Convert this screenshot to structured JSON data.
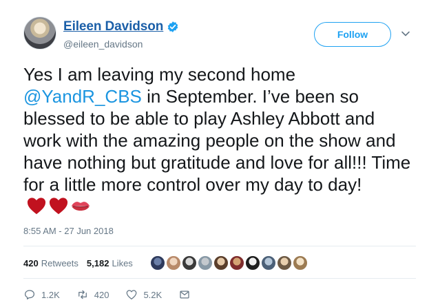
{
  "user": {
    "display_name": "Eileen Davidson",
    "handle": "@eileen_davidson",
    "verified": true
  },
  "follow_label": "Follow",
  "tweet": {
    "text_before": "Yes I am leaving my second home ",
    "mention": "@YandR_CBS",
    "text_after": " in September. I’ve been so blessed to be able to play Ashley Abbott and work with the amazing people on the show and have nothing but gratitude and love for all!!! Time for a little more control over my day to day!",
    "emojis": [
      "heart-icon",
      "heart-icon",
      "kiss-icon"
    ]
  },
  "timestamp": "8:55 AM - 27 Jun 2018",
  "stats": {
    "retweets_count": "420",
    "retweets_label": "Retweets",
    "likes_count": "5,182",
    "likes_label": "Likes"
  },
  "liker_avatar_count": 10,
  "actions": {
    "replies": "1.2K",
    "retweets": "420",
    "likes": "5.2K"
  },
  "colors": {
    "name_link": "#1b5fa8",
    "accent": "#1da1f2",
    "mention": "#1b95e0",
    "muted": "#657786",
    "heart": "#c1121f",
    "lips": "#e0445a"
  }
}
